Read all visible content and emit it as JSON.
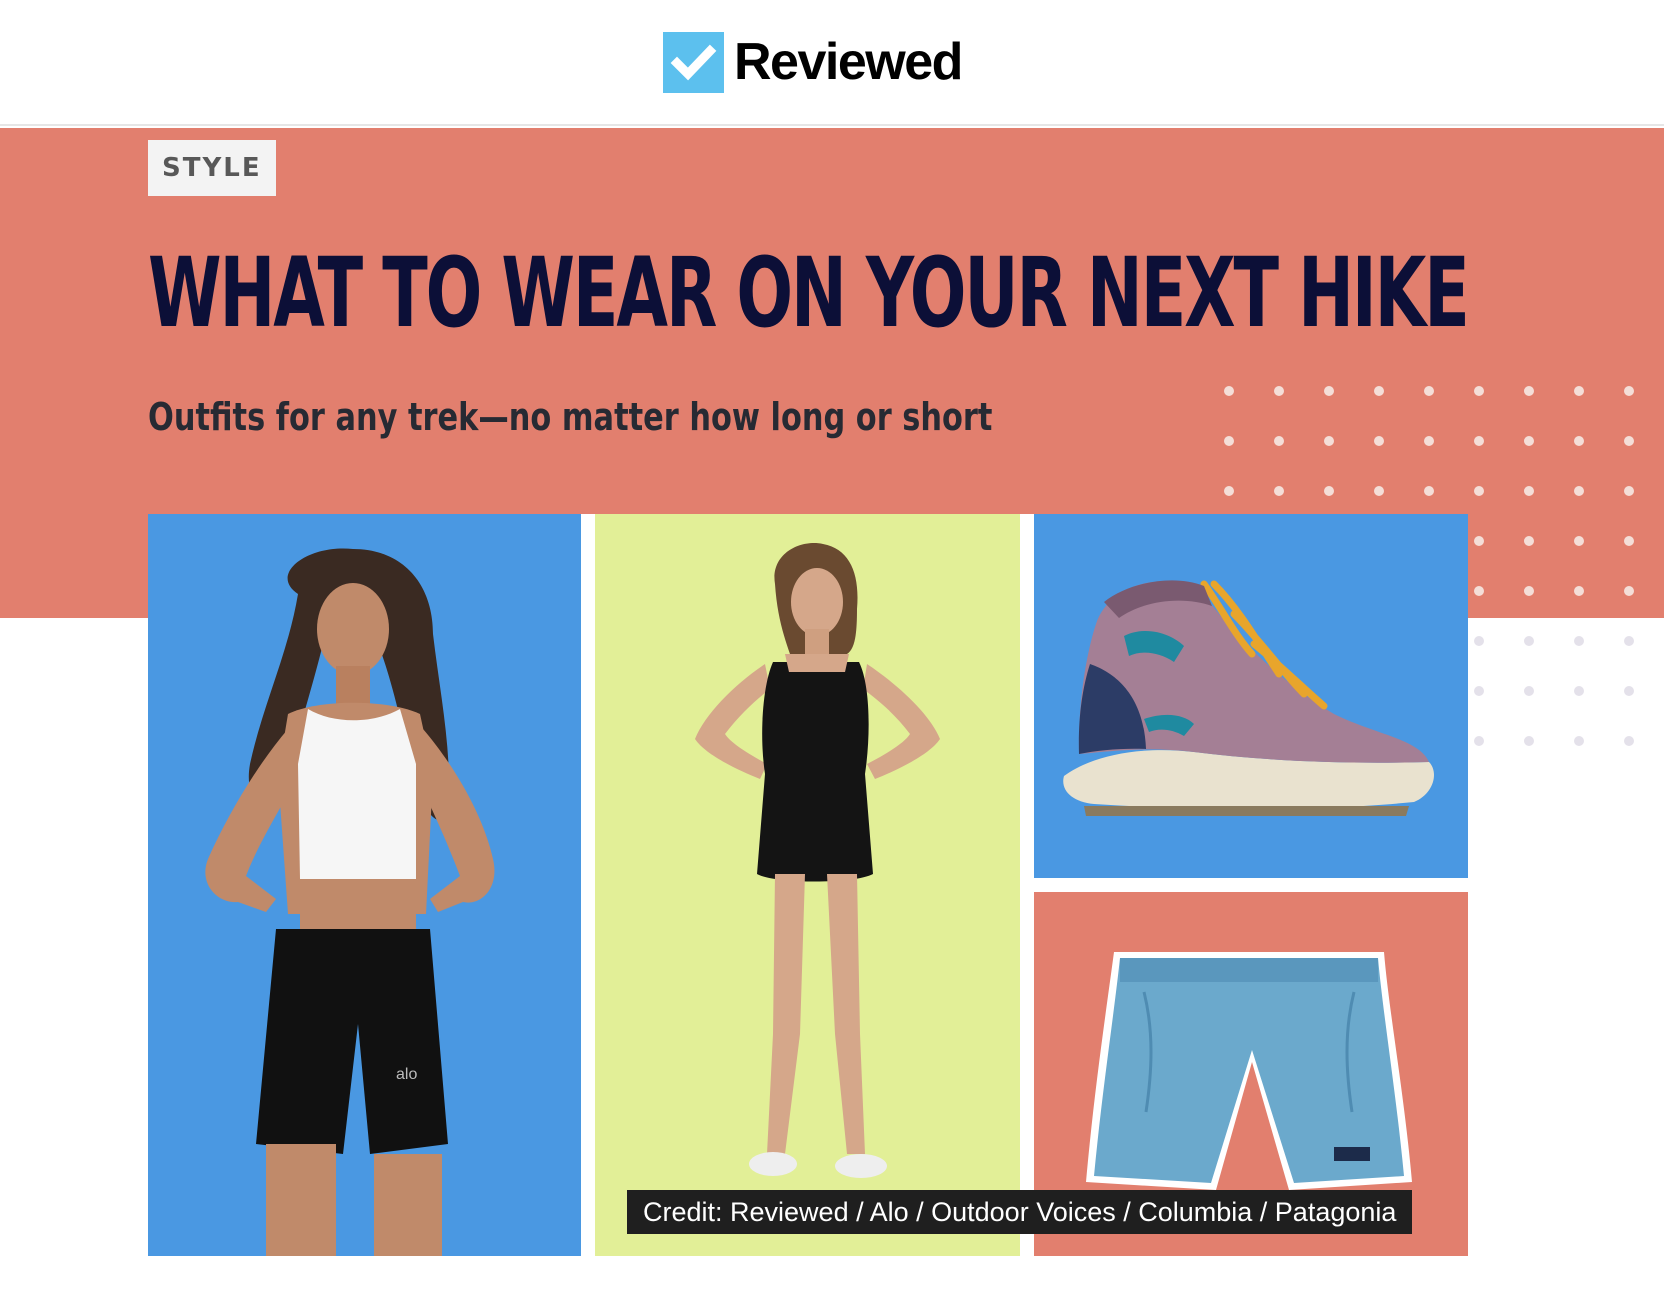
{
  "header": {
    "logo_text": "Reviewed",
    "logo_icon": "checkmark-icon",
    "brand_color": "#5cc0ee"
  },
  "hero": {
    "background_color": "#e27f6e",
    "category": "STYLE",
    "headline": "WHAT TO WEAR ON YOUR NEXT HIKE",
    "dek": "Outfits for any trek—no matter how long or short",
    "headline_color": "#0c0f37"
  },
  "collage": {
    "panels": [
      {
        "subject": "model-crop-top-shorts",
        "background": "#4a98e2",
        "garment_text": "alo"
      },
      {
        "subject": "model-athletic-dress",
        "background": "#e2ef97"
      },
      {
        "subject": "hiking-boot",
        "background": "#4a98e2"
      },
      {
        "subject": "blue-shorts",
        "background": "#e27f6e"
      }
    ],
    "credit": "Credit: Reviewed / Alo / Outdoor Voices / Columbia / Patagonia"
  }
}
